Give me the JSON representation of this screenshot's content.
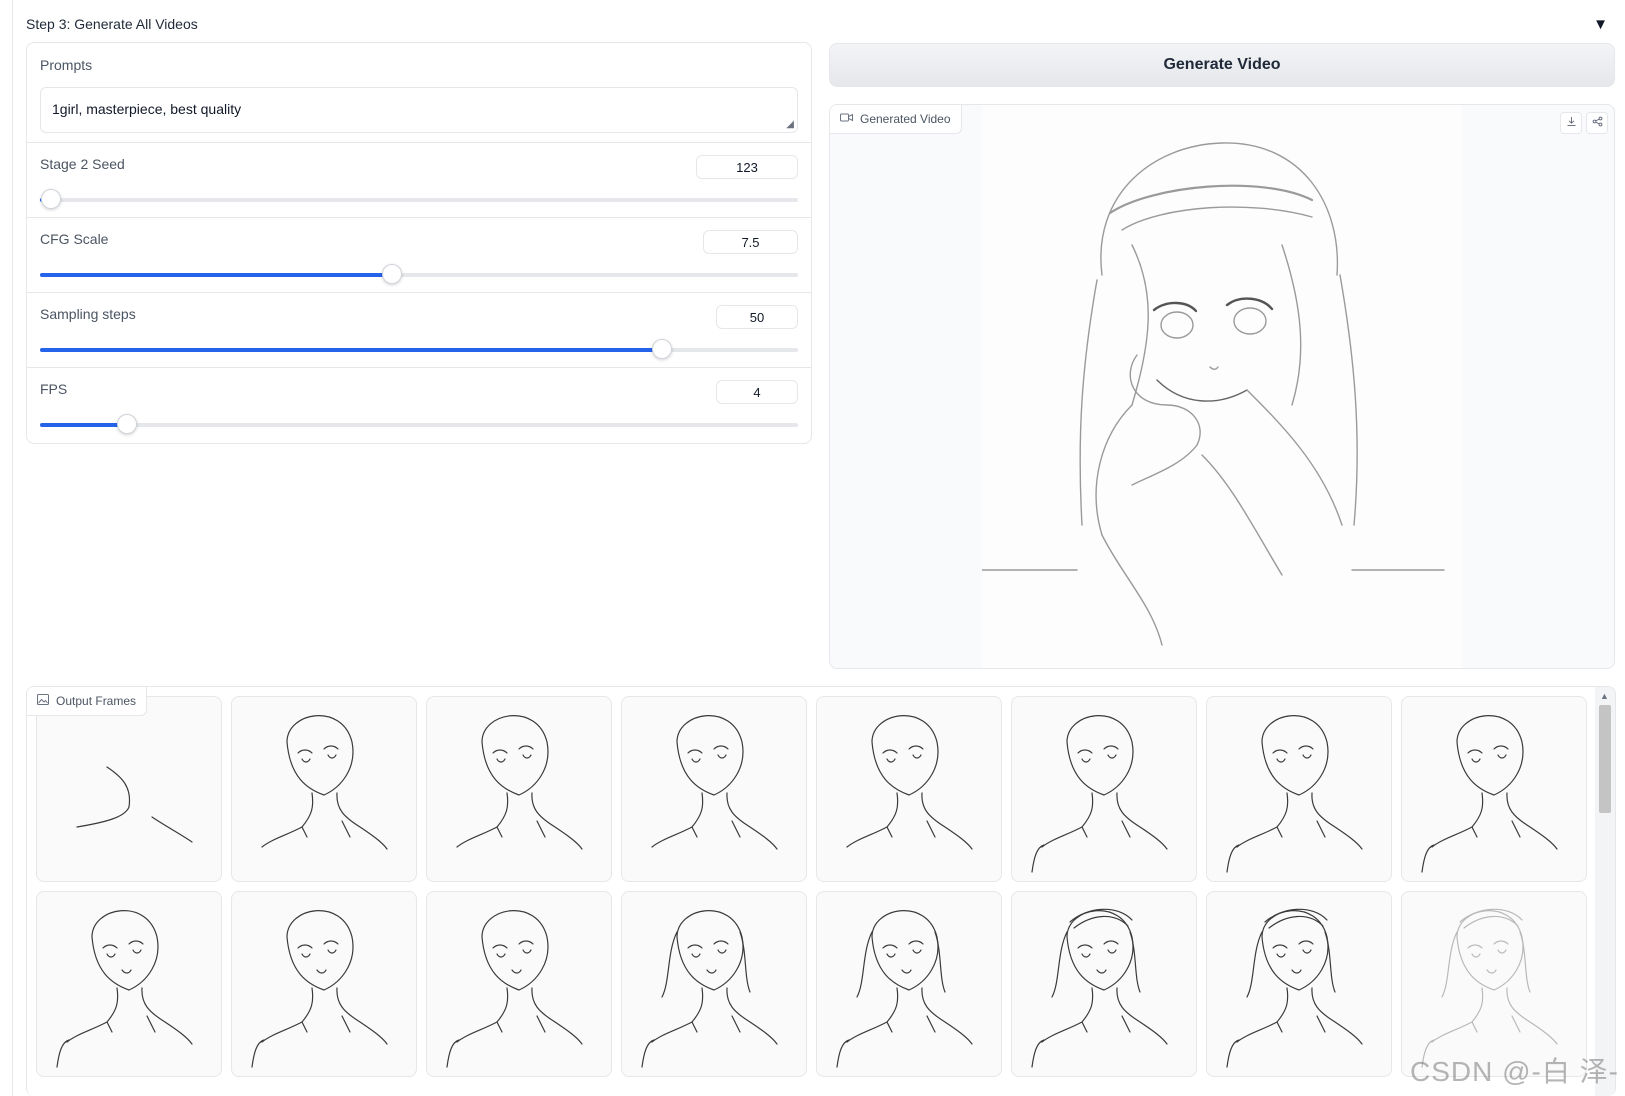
{
  "accordion": {
    "title": "Step 3: Generate All Videos",
    "arrow": "▼"
  },
  "prompt": {
    "label": "Prompts",
    "value": "1girl, masterpiece, best quality"
  },
  "sliders": [
    {
      "label": "Stage 2 Seed",
      "value": "123",
      "fraction": 0.015
    },
    {
      "label": "CFG Scale",
      "value": "7.5",
      "fraction": 0.465
    },
    {
      "label": "Sampling steps",
      "value": "50",
      "fraction": 0.82
    },
    {
      "label": "FPS",
      "value": "4",
      "fraction": 0.115
    }
  ],
  "generate_button": {
    "label": "Generate Video"
  },
  "video": {
    "label": "Generated Video",
    "icon": "video-camera-icon"
  },
  "frames": {
    "label": "Output Frames",
    "icon": "image-icon",
    "count": 16
  },
  "watermark": "CSDN @-白 泽-"
}
